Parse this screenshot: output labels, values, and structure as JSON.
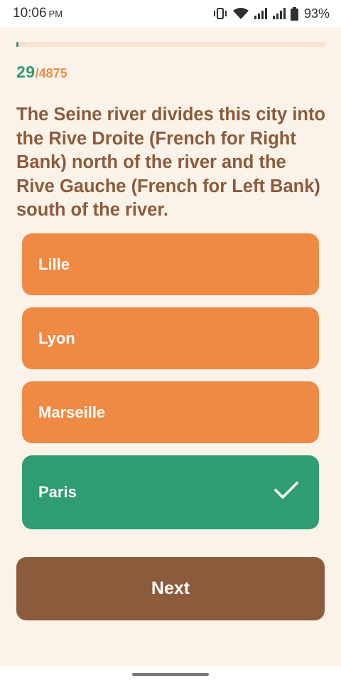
{
  "status_bar": {
    "time": "10:06",
    "ampm": "PM",
    "battery_percent": "93%",
    "icons": [
      "vibrate-icon",
      "wifi-icon",
      "signal-icon",
      "signal-icon",
      "battery-icon"
    ]
  },
  "progress": {
    "current": "29",
    "total": "/4875",
    "fraction": 0.006
  },
  "question": {
    "text": "The Seine river divides this city into the Rive Droite (French for Right Bank) north of the river and the Rive Gauche (French for Left Bank) south of the river."
  },
  "answers": [
    {
      "label": "Lille",
      "state": "neutral"
    },
    {
      "label": "Lyon",
      "state": "neutral"
    },
    {
      "label": "Marseille",
      "state": "neutral"
    },
    {
      "label": "Paris",
      "state": "correct",
      "icon": "checkmark-icon"
    }
  ],
  "next_button": {
    "label": "Next"
  },
  "colors": {
    "background": "#fbf3ea",
    "accent_green": "#2f9c71",
    "accent_orange": "#ef8a45",
    "brown": "#8c5b3b"
  }
}
